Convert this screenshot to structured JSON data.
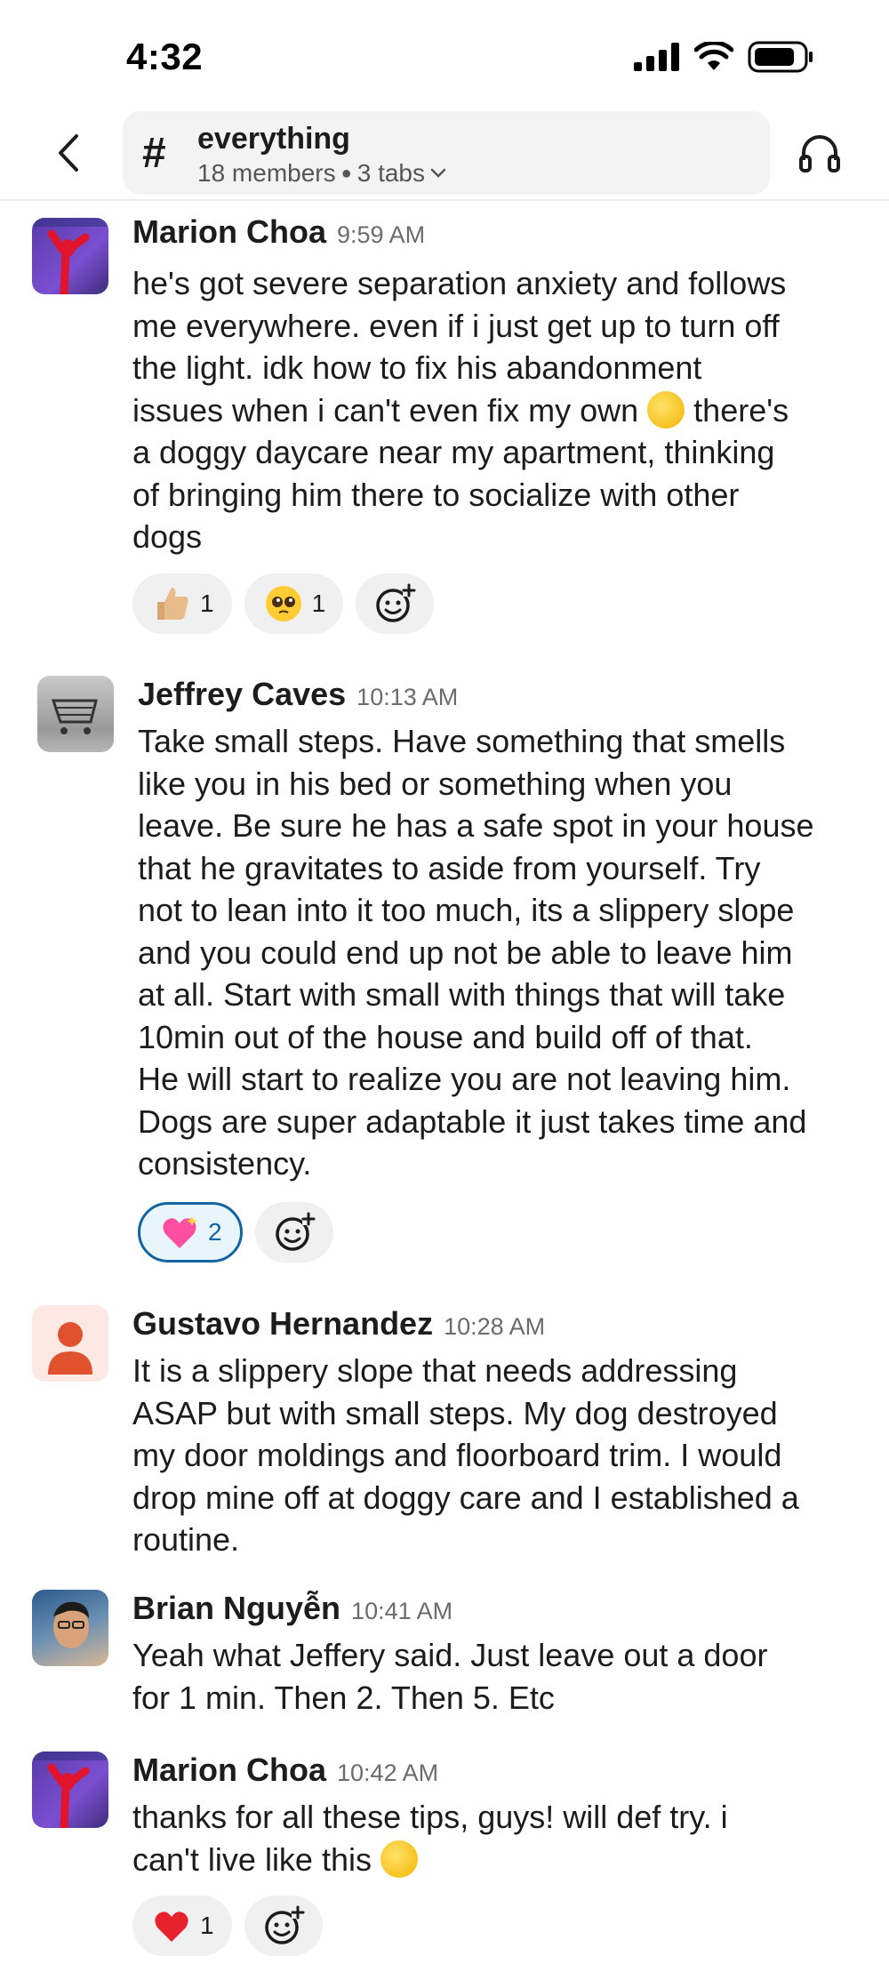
{
  "status_bar": {
    "time": "4:32"
  },
  "header": {
    "channel_name": "everything",
    "members": "18 members",
    "tabs": "3 tabs"
  },
  "icons": {
    "back": "chevron-left-icon",
    "channel": "hash-icon",
    "huddle": "headphones-icon",
    "add_reaction": "add-emoji-icon"
  },
  "colors": {
    "accent": "#1264a3",
    "reaction_bg": "#f0f0f0"
  },
  "messages": [
    {
      "author": "Marion Choa",
      "time": "9:59 AM",
      "lines": [
        "he's got severe separation anxiety and follows",
        "me everywhere. even if i just get up to turn off",
        "the light. idk how to fix his abandonment",
        "issues when i can't even fix my own",
        "there's",
        "a doggy daycare near my apartment, thinking",
        "of bringing him there to socialize with other",
        "dogs"
      ],
      "reactions": [
        {
          "emoji": "thumbs-up",
          "count": "1",
          "active": false
        },
        {
          "emoji": "pleading-face",
          "count": "1",
          "active": false
        }
      ]
    },
    {
      "author": "Jeffrey Caves",
      "time": "10:13 AM",
      "lines": [
        "Take small steps. Have something that smells",
        "like you in his bed or something when you",
        "leave. Be sure he has a safe spot in your house",
        "that he gravitates to aside from yourself. Try",
        "not to lean into it too much, its a slippery slope",
        "and you could end up not be able to leave him",
        "at all. Start with small with things that will take",
        "10min out of the house and build off of that.",
        "He will start to realize you are not leaving him.",
        "Dogs are super adaptable it just takes time and",
        "consistency."
      ],
      "reactions": [
        {
          "emoji": "sparkling-heart",
          "count": "2",
          "active": true
        }
      ]
    },
    {
      "author": "Gustavo Hernandez",
      "time": "10:28 AM",
      "lines": [
        "It is a slippery slope that needs addressing",
        "ASAP but with small steps. My dog destroyed",
        "my door moldings and floorboard trim.  I would",
        "drop mine off at doggy care and I established a",
        "routine."
      ]
    },
    {
      "author": "Brian Nguyễn",
      "time": "10:41 AM",
      "lines": [
        "Yeah what Jeffery said. Just leave out a door",
        "for 1 min. Then 2. Then 5. Etc"
      ]
    },
    {
      "author": "Marion Choa",
      "time": "10:42 AM",
      "lines": [
        "thanks for all these tips, guys! will def try. i",
        "can't live like this"
      ],
      "reactions": [
        {
          "emoji": "red-heart",
          "count": "1",
          "active": false
        }
      ]
    }
  ]
}
